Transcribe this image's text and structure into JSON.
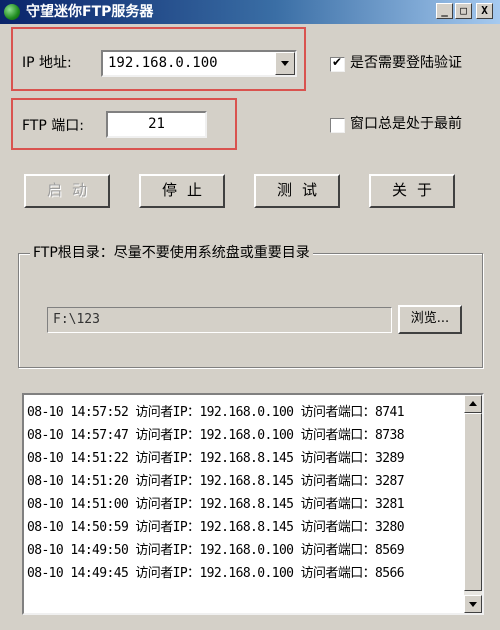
{
  "window": {
    "title": "守望迷你FTP服务器",
    "min_glyph": "_",
    "max_glyph": "□",
    "close_glyph": "X"
  },
  "settings": {
    "ip_label": "IP 地址:",
    "ip_value": "192.168.0.100",
    "port_label": "FTP 端口:",
    "port_value": "21",
    "login_verify_label": "是否需要登陆验证",
    "login_verify_checked": true,
    "always_on_top_label": "窗口总是处于最前",
    "always_on_top_checked": false
  },
  "buttons": {
    "start": "启动",
    "stop": "停止",
    "test": "测试",
    "about": "关于"
  },
  "ftp_root": {
    "group_title": "FTP根目录：尽量不要使用系统盘或重要目录",
    "path": "F:\\123",
    "browse_label": "浏览..."
  },
  "log": {
    "lines": [
      "08-10 14:57:52 访问者IP：192.168.0.100  访问者端口：8741",
      "08-10 14:57:47 访问者IP：192.168.0.100  访问者端口：8738",
      "08-10 14:51:22 访问者IP：192.168.8.145  访问者端口：3289",
      "08-10 14:51:20 访问者IP：192.168.8.145  访问者端口：3287",
      "08-10 14:51:00 访问者IP：192.168.8.145  访问者端口：3281",
      "08-10 14:50:59 访问者IP：192.168.8.145  访问者端口：3280",
      "08-10 14:49:50 访问者IP：192.168.0.100  访问者端口：8569",
      "08-10 14:49:45 访问者IP：192.168.0.100  访问者端口：8566"
    ]
  },
  "icons": {
    "app": "ftp-server-icon",
    "dropdown": "chevron-down-icon",
    "scroll_up": "arrow-up-icon",
    "scroll_down": "arrow-down-icon"
  },
  "colors": {
    "highlight": "#d9534f",
    "titlebar": "#0a246a",
    "window": "#d4d0c8"
  }
}
